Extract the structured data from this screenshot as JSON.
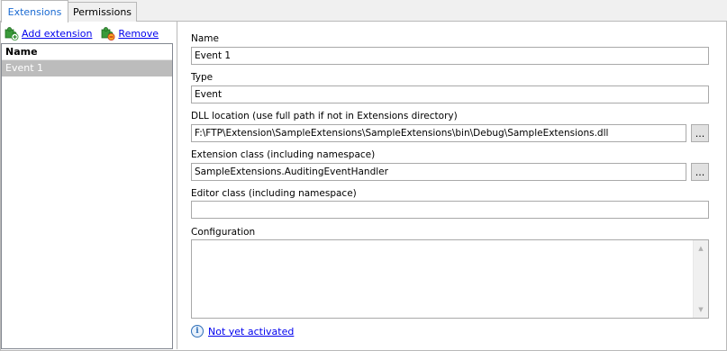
{
  "tabs": [
    {
      "label": "Extensions",
      "active": true
    },
    {
      "label": "Permissions",
      "active": false
    }
  ],
  "toolbar": {
    "add_label": "Add extension",
    "remove_label": "Remove",
    "add_icon": "add-puzzle-icon",
    "remove_icon": "remove-puzzle-icon"
  },
  "list": {
    "header": "Name",
    "items": [
      {
        "label": "Event 1",
        "selected": true
      }
    ]
  },
  "form": {
    "name_label": "Name",
    "name_value": "Event 1",
    "type_label": "Type",
    "type_value": "Event",
    "dll_label": "DLL location (use full path if not in Extensions directory)",
    "dll_value": "F:\\FTP\\Extension\\SampleExtensions\\SampleExtensions\\bin\\Debug\\SampleExtensions.dll",
    "dll_browse": "...",
    "class_label": "Extension class (including namespace)",
    "class_value": "SampleExtensions.AuditingEventHandler",
    "class_browse": "...",
    "editor_label": "Editor class (including namespace)",
    "editor_value": "",
    "config_label": "Configuration",
    "config_value": ""
  },
  "status": {
    "icon": "info-icon",
    "text": "Not yet activated"
  },
  "colors": {
    "active_tab_text": "#1a6ad2",
    "link": "#0000ee",
    "selected_row": "#bcbcbc"
  }
}
